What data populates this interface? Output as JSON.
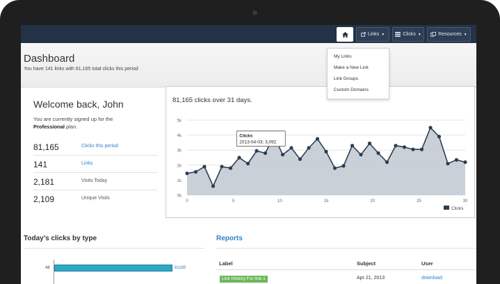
{
  "navbar": {
    "links_label": "Links",
    "clicks_label": "Clicks",
    "resources_label": "Resources",
    "dropdown": [
      "My Links",
      "Make a New Link",
      "Link Groups",
      "Custom Domains"
    ]
  },
  "header": {
    "title": "Dashboard",
    "subtitle": "You have 141 links with 81,165 total clicks this period"
  },
  "welcome": {
    "greeting": "Welcome back, John",
    "plan_line1": "You are currently signed up for the",
    "plan_name": "Professional",
    "plan_suffix": " plan."
  },
  "stats": [
    {
      "value": "81,165",
      "label": "Clicks this period"
    },
    {
      "value": "141",
      "label": "Links"
    },
    {
      "value": "2,181",
      "label": "Visits Today"
    },
    {
      "value": "2,109",
      "label": "Unique Visits"
    }
  ],
  "colors": {
    "accent": "#2f80c8",
    "navbar": "#233246",
    "chart_fill": "#c3cbd3",
    "chart_line": "#2c3e50",
    "bar": "#2da8c8",
    "badge": "#6cb85a"
  },
  "chart_data": {
    "type": "area",
    "title": "81,165 clicks over 31 days.",
    "x": [
      0,
      1,
      2,
      3,
      4,
      5,
      6,
      7,
      8,
      9,
      10,
      11,
      12,
      13,
      14,
      15,
      16,
      17,
      18,
      19,
      20,
      21,
      22,
      23,
      24,
      25,
      26,
      27,
      28,
      29,
      30
    ],
    "series": [
      {
        "name": "Clicks",
        "values": [
          1450,
          1550,
          1900,
          600,
          1900,
          1800,
          2500,
          2100,
          2950,
          2800,
          3950,
          2700,
          3150,
          2400,
          3150,
          3750,
          2900,
          1800,
          1950,
          3300,
          2700,
          3450,
          2800,
          2200,
          3300,
          3200,
          3050,
          3050,
          4500,
          3900,
          2100,
          2350,
          2200
        ]
      }
    ],
    "xticks": [
      0,
      5,
      10,
      15,
      20,
      25,
      30
    ],
    "yticks": [
      "0k",
      "1k",
      "2k",
      "3k",
      "4k",
      "5k"
    ],
    "ylim": [
      0,
      5000
    ],
    "xlim": [
      0,
      30
    ],
    "grid": true,
    "legend": "bottom-right",
    "tooltip": {
      "title": "Clicks",
      "text": "2013-04-03: 3,092"
    }
  },
  "todays_clicks": {
    "title": "Today's clicks by type",
    "bar_label": "All",
    "bar_value": "81165"
  },
  "reports": {
    "title": "Reports",
    "columns": [
      "Label",
      "Subject",
      "User"
    ],
    "rows": [
      {
        "label": "Link History For link-1",
        "subject": "Apr 21, 2013",
        "user": "download"
      }
    ]
  }
}
